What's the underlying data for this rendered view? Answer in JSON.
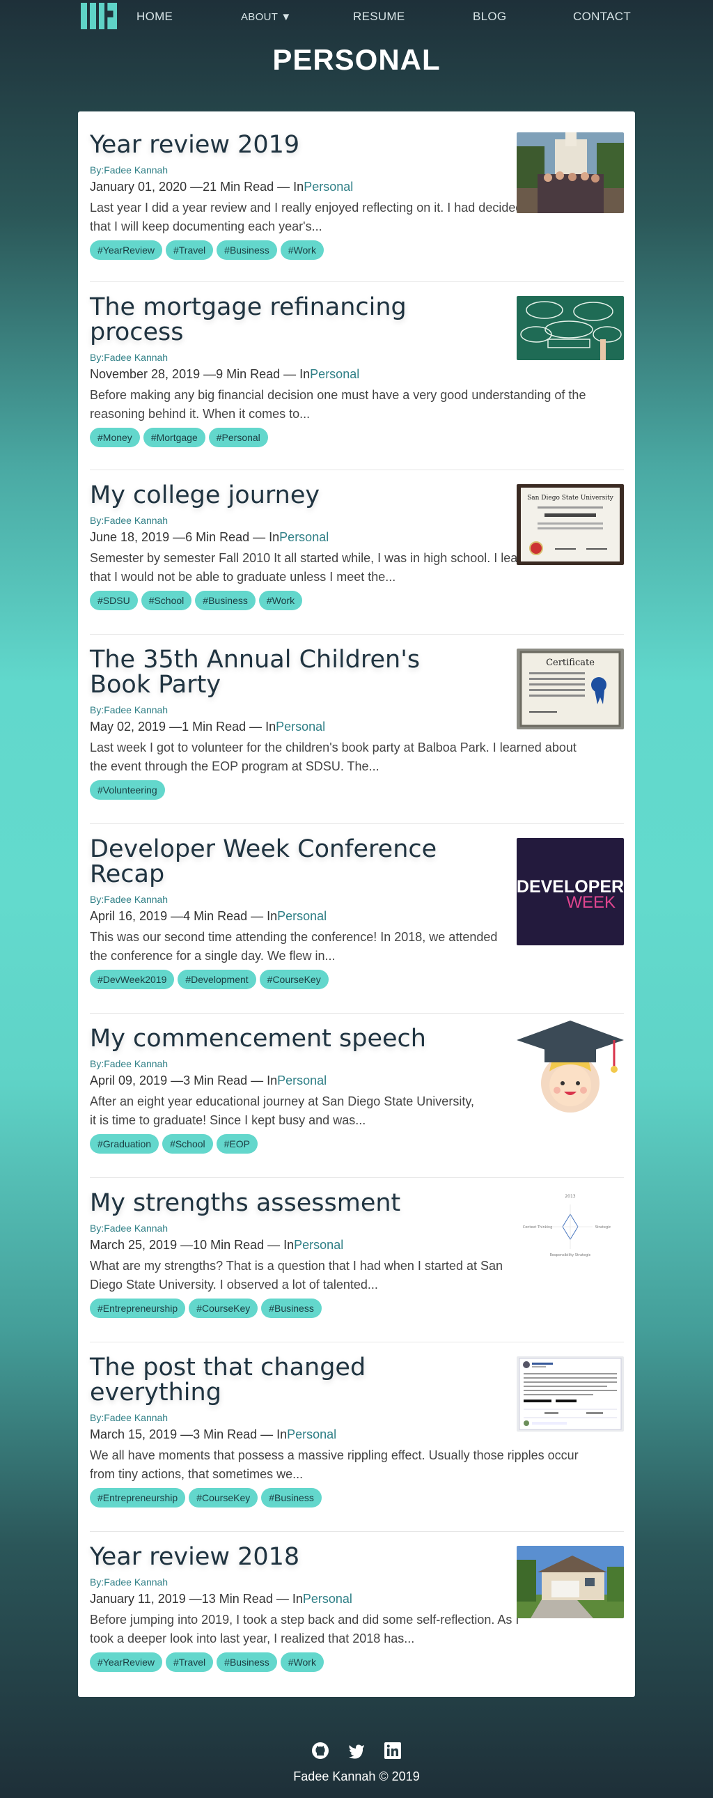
{
  "nav": {
    "home": "HOME",
    "about": "ABOUT ▼",
    "resume": "RESUME",
    "blog": "BLOG",
    "contact": "CONTACT"
  },
  "page_title": "PERSONAL",
  "posts": [
    {
      "title": "Year review 2019",
      "byline": "By:Fadee Kannah",
      "meta_prefix": "January 01, 2020 —21 Min Read — In",
      "category": "Personal",
      "excerpt": "Last year I did a year review and I really enjoyed reflecting on it. I had decided that I will keep documenting each year's...",
      "tags": [
        "#YearReview",
        "#Travel",
        "#Business",
        "#Work"
      ]
    },
    {
      "title": "The mortgage refinancing process",
      "byline": "By:Fadee Kannah",
      "meta_prefix": "November 28, 2019 —9 Min Read — In",
      "category": "Personal",
      "excerpt": "Before making any big financial decision one must have a very good understanding of the reasoning behind it. When it comes to...",
      "tags": [
        "#Money",
        "#Mortgage",
        "#Personal"
      ]
    },
    {
      "title": "My college journey",
      "byline": "By:Fadee Kannah",
      "meta_prefix": "June 18, 2019 —6 Min Read — In",
      "category": "Personal",
      "excerpt": "Semester by semester Fall 2010 It all started while, I was in high school. I learned that I would not be able to graduate unless I meet the...",
      "tags": [
        "#SDSU",
        "#School",
        "#Business",
        "#Work"
      ]
    },
    {
      "title": "The 35th Annual Children's Book Party",
      "byline": "By:Fadee Kannah",
      "meta_prefix": "May 02, 2019 —1 Min Read — In",
      "category": "Personal",
      "excerpt": "Last week I got to volunteer for the children's book party at Balboa Park. I learned about the event through the EOP program at SDSU. The...",
      "tags": [
        "#Volunteering"
      ]
    },
    {
      "title": "Developer Week Conference Recap",
      "byline": "By:Fadee Kannah",
      "meta_prefix": "April 16, 2019 —4 Min Read — In",
      "category": "Personal",
      "excerpt": "This was our second time attending the conference! In 2018, we attended the conference for a single day. We flew in...",
      "tags": [
        "#DevWeek2019",
        "#Development",
        "#CourseKey"
      ]
    },
    {
      "title": "My commencement speech",
      "byline": "By:Fadee Kannah",
      "meta_prefix": "April 09, 2019 —3 Min Read — In",
      "category": "Personal",
      "excerpt": "After an eight year educational journey at San Diego State University, it is time to graduate! Since I kept busy and was...",
      "tags": [
        "#Graduation",
        "#School",
        "#EOP"
      ]
    },
    {
      "title": "My strengths assessment",
      "byline": "By:Fadee Kannah",
      "meta_prefix": "March 25, 2019 —10 Min Read — In",
      "category": "Personal",
      "excerpt": "What are my strengths? That is a question that I had when I started at San Diego State University. I observed a lot of talented...",
      "tags": [
        "#Entrepreneurship",
        "#CourseKey",
        "#Business"
      ]
    },
    {
      "title": "The post that changed everything",
      "byline": "By:Fadee Kannah",
      "meta_prefix": "March 15, 2019 —3 Min Read — In",
      "category": "Personal",
      "excerpt": "We all have moments that possess a massive rippling effect. Usually those ripples occur from tiny actions, that sometimes we...",
      "tags": [
        "#Entrepreneurship",
        "#CourseKey",
        "#Business"
      ]
    },
    {
      "title": "Year review 2018",
      "byline": "By:Fadee Kannah",
      "meta_prefix": "January 11, 2019 —13 Min Read — In",
      "category": "Personal",
      "excerpt": "Before jumping into 2019, I took a step back and did some self-reflection. As I took a deeper look into last year, I realized that 2018 has...",
      "tags": [
        "#YearReview",
        "#Travel",
        "#Business",
        "#Work"
      ]
    }
  ],
  "thumbs": {
    "cert1_title": "San Diego State University",
    "cert2_title": "Certificate",
    "dev_line1": "DEVELOPER",
    "dev_line2": "WEEK",
    "strengths_top": "2013",
    "strengths_left": "Context Thinking",
    "strengths_right": "Strategic",
    "strengths_bottom": "Responsibility Strategic"
  },
  "footer": {
    "copyright": "Fadee Kannah © 2019",
    "icons": [
      "github-icon",
      "twitter-icon",
      "linkedin-icon"
    ]
  },
  "colors": {
    "accent": "#63d7cc",
    "link": "#2f7f86",
    "heading": "#1f3340"
  }
}
